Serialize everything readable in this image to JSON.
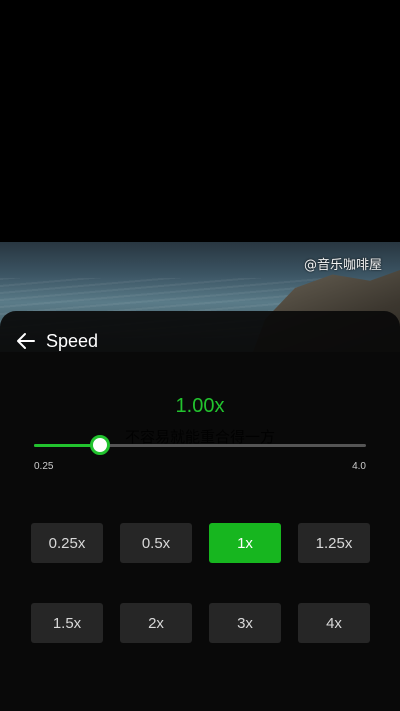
{
  "video": {
    "watermark": "@音乐咖啡屋",
    "lyric": "不容易就能重合得一方"
  },
  "panel": {
    "title": "Speed",
    "back_icon": "arrow-left-icon"
  },
  "speed": {
    "current_label": "1.00x",
    "value": 1.0,
    "min": 0.25,
    "max": 4.0,
    "min_label": "0.25",
    "max_label": "4.0",
    "accent": "#22c32e"
  },
  "options": [
    {
      "label": "0.25x",
      "selected": false
    },
    {
      "label": "0.5x",
      "selected": false
    },
    {
      "label": "1x",
      "selected": true
    },
    {
      "label": "1.25x",
      "selected": false
    },
    {
      "label": "1.5x",
      "selected": false
    },
    {
      "label": "2x",
      "selected": false
    },
    {
      "label": "3x",
      "selected": false
    },
    {
      "label": "4x",
      "selected": false
    }
  ]
}
